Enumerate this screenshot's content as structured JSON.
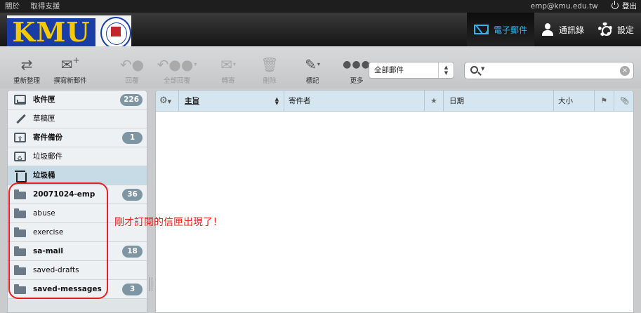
{
  "topbar": {
    "links": [
      "關於",
      "取得支援"
    ],
    "user_email": "emp@kmu.edu.tw",
    "logout_label": "登出"
  },
  "logo": {
    "text": "KMU"
  },
  "nav": [
    {
      "label": "電子郵件",
      "icon": "mail-icon",
      "active": true
    },
    {
      "label": "通訊錄",
      "icon": "person-icon",
      "active": false
    },
    {
      "label": "設定",
      "icon": "gear-icon",
      "active": false
    }
  ],
  "toolbar": {
    "refresh": "重新整理",
    "compose": "撰寫新郵件",
    "reply": "回覆",
    "reply_all": "全部回覆",
    "forward": "轉寄",
    "delete": "刪除",
    "mark": "標記",
    "more": "更多"
  },
  "folder_filter": {
    "selected": "全部郵件"
  },
  "search": {
    "placeholder": ""
  },
  "folders": [
    {
      "name": "收件匣",
      "icon": "inbox-icon",
      "count": "226",
      "bold": true
    },
    {
      "name": "草稿匣",
      "icon": "pencil-icon",
      "count": "",
      "bold": false
    },
    {
      "name": "寄件備份",
      "icon": "sent-icon",
      "count": "1",
      "bold": true
    },
    {
      "name": "垃圾郵件",
      "icon": "junk-icon",
      "count": "",
      "bold": false
    },
    {
      "name": "垃圾桶",
      "icon": "trash-icon",
      "count": "",
      "bold": true,
      "selected": true
    },
    {
      "name": "20071024-emp",
      "icon": "folder-icon",
      "count": "36",
      "bold": true
    },
    {
      "name": "abuse",
      "icon": "folder-icon",
      "count": "",
      "bold": false
    },
    {
      "name": "exercise",
      "icon": "folder-icon",
      "count": "",
      "bold": false
    },
    {
      "name": "sa-mail",
      "icon": "folder-icon",
      "count": "18",
      "bold": true
    },
    {
      "name": "saved-drafts",
      "icon": "folder-icon",
      "count": "",
      "bold": false
    },
    {
      "name": "saved-messages",
      "icon": "folder-icon",
      "count": "3",
      "bold": true
    }
  ],
  "columns": {
    "subject": "主旨",
    "from": "寄件者",
    "date": "日期",
    "size": "大小"
  },
  "annotation": "剛才訂閱的信匣出現了！",
  "colors": {
    "accent": "#37b3ef",
    "badge": "#7e95a4",
    "annotation": "#e8211d"
  }
}
